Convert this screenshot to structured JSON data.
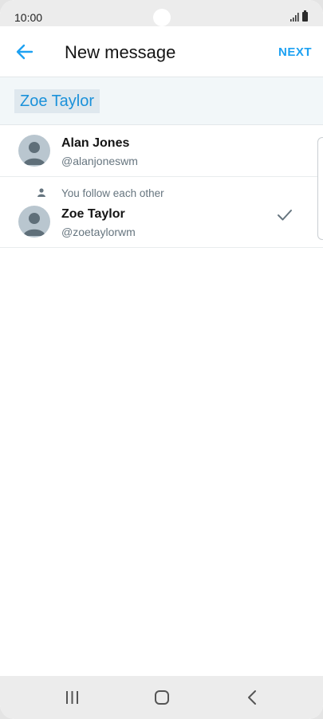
{
  "status_bar": {
    "time": "10:00"
  },
  "header": {
    "title": "New message",
    "next_label": "NEXT"
  },
  "recipients": {
    "chip_label": "Zoe Taylor"
  },
  "contacts": [
    {
      "name": "Alan Jones",
      "handle": "@alanjoneswm"
    },
    {
      "social_context": "You follow each other",
      "name": "Zoe Taylor",
      "handle": "@zoetaylorwm",
      "selected": true
    }
  ],
  "colors": {
    "accent": "#1da1f2",
    "chip_bg": "#dfe8ee",
    "recipients_bg": "#f2f7f9"
  },
  "icons": {
    "back": "arrow-left-icon",
    "selected": "checkmark-icon",
    "social": "person-icon",
    "nav": [
      "recent-apps-icon",
      "home-icon",
      "back-icon"
    ]
  }
}
